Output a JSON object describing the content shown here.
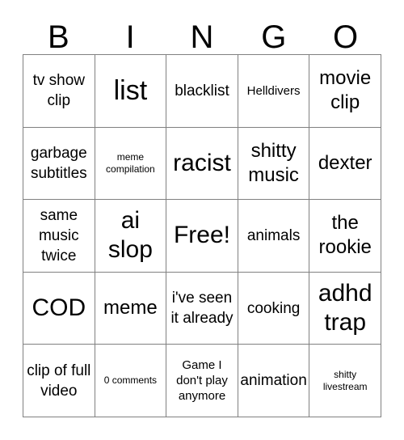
{
  "card": {
    "title": "BINGO",
    "header_letters": [
      "B",
      "I",
      "N",
      "G",
      "O"
    ],
    "grid_line_color": "#808080",
    "text_color": "#000000",
    "background_color": "#ffffff",
    "rows": 5,
    "columns": 5,
    "free_space": {
      "row": 3,
      "column": 3,
      "label": "Free!"
    },
    "cells": [
      [
        {
          "label": "tv show clip",
          "size": "m"
        },
        {
          "label": "list",
          "size": "xxl"
        },
        {
          "label": "blacklist",
          "size": "m"
        },
        {
          "label": "Helldivers",
          "size": "s"
        },
        {
          "label": "movie clip",
          "size": "l"
        }
      ],
      [
        {
          "label": "garbage subtitles",
          "size": "m"
        },
        {
          "label": "meme compilation",
          "size": "xs"
        },
        {
          "label": "racist",
          "size": "xl"
        },
        {
          "label": "shitty music",
          "size": "l"
        },
        {
          "label": "dexter",
          "size": "l"
        }
      ],
      [
        {
          "label": "same music twice",
          "size": "m"
        },
        {
          "label": "ai slop",
          "size": "xl"
        },
        {
          "label": "Free!",
          "size": "xl"
        },
        {
          "label": "animals",
          "size": "m"
        },
        {
          "label": "the rookie",
          "size": "l"
        }
      ],
      [
        {
          "label": "COD",
          "size": "xl"
        },
        {
          "label": "meme",
          "size": "l"
        },
        {
          "label": "i've seen it already",
          "size": "m"
        },
        {
          "label": "cooking",
          "size": "m"
        },
        {
          "label": "adhd trap",
          "size": "xl"
        }
      ],
      [
        {
          "label": "clip of full video",
          "size": "m"
        },
        {
          "label": "0 comments",
          "size": "xs"
        },
        {
          "label": "Game I don't play anymore",
          "size": "s"
        },
        {
          "label": "animation",
          "size": "m"
        },
        {
          "label": "shitty livestream",
          "size": "xs"
        }
      ]
    ]
  }
}
